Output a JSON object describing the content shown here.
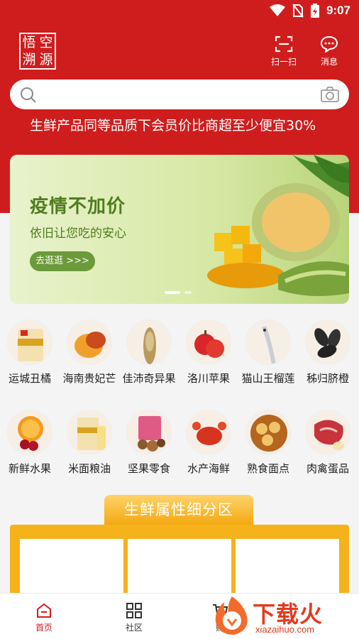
{
  "status_bar": {
    "time": "9:07"
  },
  "header": {
    "logo_chars": [
      "悟",
      "空",
      "溯",
      "源"
    ],
    "scan_label": "扫一扫",
    "message_label": "消息"
  },
  "search": {
    "placeholder": "",
    "value": ""
  },
  "promo_text": "生鲜产品同等品质下会员价比商超至少便宜30%",
  "banner": {
    "title": "疫情不加价",
    "subtitle": "依旧让您吃的安心",
    "button_label": "去逛逛 >>>",
    "active_slide": 1,
    "slide_count": 2
  },
  "categories_row1": [
    {
      "label": "运城丑橘",
      "icon": "orange-bag-icon"
    },
    {
      "label": "海南贵妃芒",
      "icon": "mango-icon"
    },
    {
      "label": "佳沛奇异果",
      "icon": "fish-icon"
    },
    {
      "label": "洛川苹果",
      "icon": "apple-icon"
    },
    {
      "label": "猫山王榴莲",
      "icon": "hairtail-icon"
    },
    {
      "label": "秭归脐橙",
      "icon": "sunflower-seed-icon"
    }
  ],
  "categories_row2": [
    {
      "label": "新鲜水果",
      "icon": "fruit-icon"
    },
    {
      "label": "米面粮油",
      "icon": "oil-icon"
    },
    {
      "label": "坚果零食",
      "icon": "nuts-icon"
    },
    {
      "label": "水产海鲜",
      "icon": "crab-icon"
    },
    {
      "label": "熟食面点",
      "icon": "dumpling-icon"
    },
    {
      "label": "肉禽蛋品",
      "icon": "meat-icon"
    }
  ],
  "section": {
    "title": "生鲜属性细分区"
  },
  "tabbar": [
    {
      "label": "首页",
      "icon": "home-icon",
      "active": true
    },
    {
      "label": "社区",
      "icon": "grid-icon",
      "active": false
    },
    {
      "label": "购",
      "icon": "cart-icon",
      "active": false
    }
  ],
  "watermark": {
    "text": "下载火",
    "url": "xiazaihuo.com"
  },
  "colors": {
    "brand_red": "#cf1d1d",
    "banner_green": "#4f7d1e",
    "section_gold": "#f5b21b",
    "tab_active": "#cf1d1d"
  }
}
